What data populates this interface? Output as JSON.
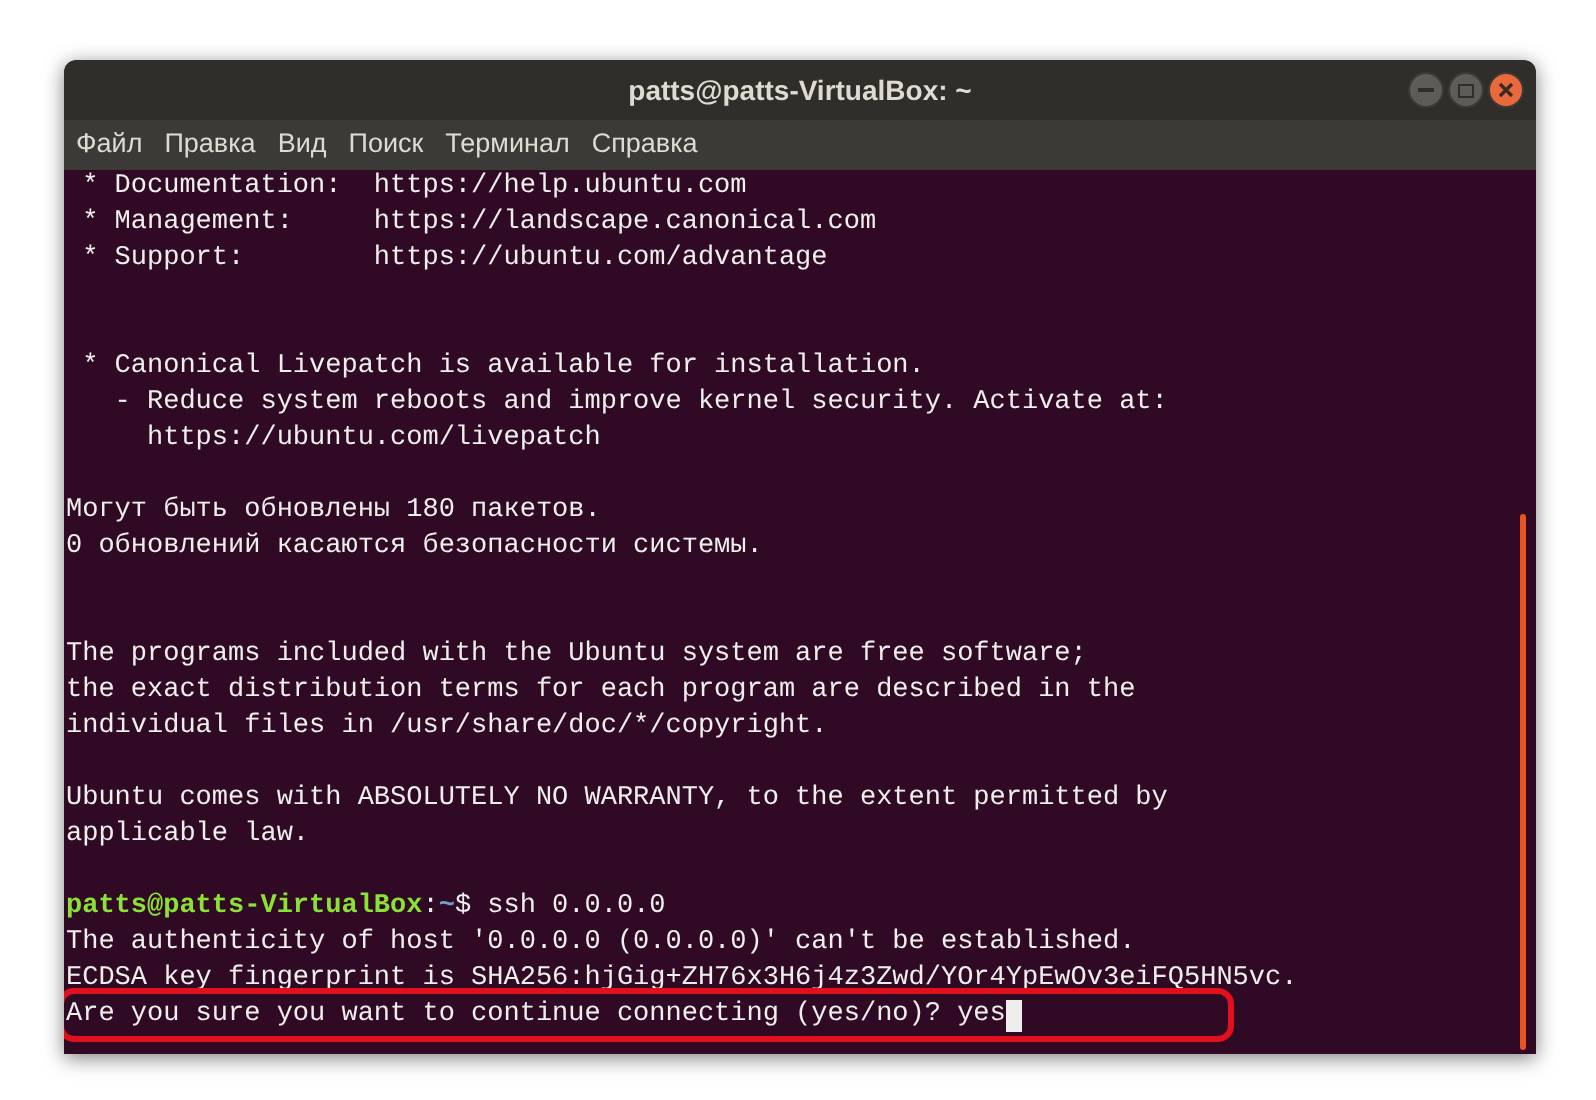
{
  "window": {
    "title": "patts@patts-VirtualBox: ~"
  },
  "menu": [
    "Файл",
    "Правка",
    "Вид",
    "Поиск",
    "Терминал",
    "Справка"
  ],
  "terminal": {
    "lines": [
      {
        "kind": "text",
        "text": " * Documentation:  https://help.ubuntu.com"
      },
      {
        "kind": "text",
        "text": " * Management:     https://landscape.canonical.com"
      },
      {
        "kind": "text",
        "text": " * Support:        https://ubuntu.com/advantage"
      },
      {
        "kind": "blank"
      },
      {
        "kind": "blank"
      },
      {
        "kind": "text",
        "text": " * Canonical Livepatch is available for installation."
      },
      {
        "kind": "text",
        "text": "   - Reduce system reboots and improve kernel security. Activate at:"
      },
      {
        "kind": "text",
        "text": "     https://ubuntu.com/livepatch"
      },
      {
        "kind": "blank"
      },
      {
        "kind": "text",
        "text": "Могут быть обновлены 180 пакетов."
      },
      {
        "kind": "text",
        "text": "0 обновлений касаются безопасности системы."
      },
      {
        "kind": "blank"
      },
      {
        "kind": "blank"
      },
      {
        "kind": "text",
        "text": "The programs included with the Ubuntu system are free software;"
      },
      {
        "kind": "text",
        "text": "the exact distribution terms for each program are described in the"
      },
      {
        "kind": "text",
        "text": "individual files in /usr/share/doc/*/copyright."
      },
      {
        "kind": "blank"
      },
      {
        "kind": "text",
        "text": "Ubuntu comes with ABSOLUTELY NO WARRANTY, to the extent permitted by"
      },
      {
        "kind": "text",
        "text": "applicable law."
      },
      {
        "kind": "blank"
      },
      {
        "kind": "prompt",
        "user_host": "patts@patts-VirtualBox",
        "separator": ":",
        "path": "~",
        "command": "$ ssh 0.0.0.0"
      },
      {
        "kind": "text",
        "text": "The authenticity of host '0.0.0.0 (0.0.0.0)' can't be established."
      },
      {
        "kind": "text",
        "text": "ECDSA key fingerprint is SHA256:hjGig+ZH76x3H6j4z3Zwd/YOr4YpEwOv3eiFQ5HN5vc."
      },
      {
        "kind": "input",
        "text": "Are you sure you want to continue connecting (yes/no)?",
        "typed": "yes",
        "cursor": true,
        "highlighted": true
      }
    ]
  }
}
